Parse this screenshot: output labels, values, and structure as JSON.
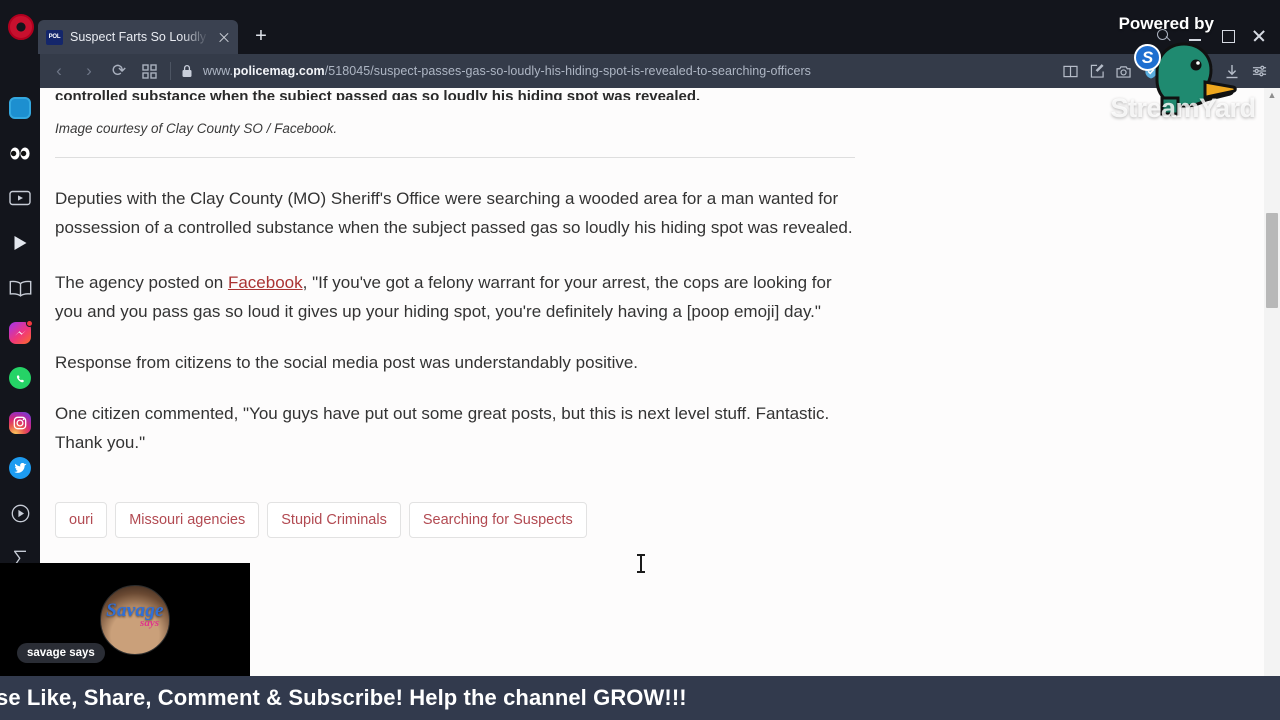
{
  "browser": {
    "name": "Opera",
    "tab": {
      "title": "Suspect Farts So Loudly Hi",
      "favicon_text": "POL",
      "favicon_name": "policemag-favicon",
      "close_label": "×"
    },
    "newtab_label": "+",
    "nav": {
      "back": "‹",
      "forward": "›",
      "reload": "⟳",
      "tabs_grid": "▦",
      "lock_icon": "lock-icon",
      "url_prefix": "www.",
      "url_domain": "policemag.com",
      "url_path": "/518045/suspect-passes-gas-so-loudly-his-hiding-spot-is-revealed-to-searching-officers"
    },
    "toolbar_icons": [
      "reader-mode-icon",
      "edit-snapshot-icon",
      "camera-icon",
      "shield-check-icon",
      "send-icon",
      "heart-icon",
      "download-icon",
      "settings-sliders-icon"
    ],
    "window_controls": [
      "search-icon",
      "minimize-icon",
      "maximize-icon",
      "close-icon"
    ]
  },
  "sidebar": {
    "items": [
      {
        "name": "workspace-tile",
        "glyph": "▭"
      },
      {
        "name": "eyes-icon",
        "glyph": "👀"
      },
      {
        "name": "video-player-icon",
        "glyph": "▣"
      },
      {
        "name": "play-icon",
        "glyph": "▶"
      },
      {
        "name": "book-icon",
        "glyph": "📖"
      },
      {
        "name": "messenger-icon",
        "glyph": "⚡"
      },
      {
        "name": "whatsapp-icon",
        "glyph": "✆"
      },
      {
        "name": "instagram-icon",
        "glyph": "◉"
      },
      {
        "name": "twitter-icon",
        "glyph": "🐦"
      },
      {
        "name": "media-player-icon",
        "glyph": "⊙"
      },
      {
        "name": "sigma-icon",
        "glyph": "Σ"
      },
      {
        "name": "crop-icon",
        "glyph": "⌐"
      }
    ]
  },
  "article": {
    "cut_heading": "controlled substance when the subject passed gas so loudly his hiding spot was revealed.",
    "caption": "Image courtesy of Clay County SO / Facebook.",
    "paragraph_1": "Deputies with the Clay County (MO) Sheriff's Office were searching a wooded area for a man wanted for possession of a controlled substance when the subject passed gas so loudly his hiding spot was revealed.",
    "paragraph_2_before": "The agency posted on ",
    "paragraph_2_link": "Facebook",
    "paragraph_2_after": ", \"If you've got a felony warrant for your arrest, the cops are looking for you and you pass gas so loud it gives up your hiding spot, you're definitely having a [poop emoji] day.\"",
    "paragraph_3": "Response from citizens to the social media post was understandably positive.",
    "paragraph_4": "One citizen commented, \"You guys have put out some great posts, but this is next level stuff. Fantastic. Thank you.\"",
    "tags": [
      "ouri",
      "Missouri agencies",
      "Stupid Criminals",
      "Searching for Suspects"
    ]
  },
  "overlay": {
    "powered_by": "Powered by",
    "brand": "StreamYard",
    "badge_letter": "S",
    "duck_icon": "duck-mascot-icon",
    "camera_label": "savage says",
    "avatar_logo": "Savage",
    "avatar_logo_sub": "says",
    "ticker_text": "se Like, Share, Comment & Subscribe! Help the channel GROW!!!"
  },
  "colors": {
    "opera_red": "#c8102e",
    "chrome_dark": "#13151c",
    "navbar": "#343b49",
    "tab_active": "#3a4150",
    "page_bg": "#fdfcfc",
    "link_red": "#aa3333",
    "tag_red": "#b24a52",
    "ticker_bg": "#323a4d",
    "badge_blue": "#1f6fd0"
  }
}
